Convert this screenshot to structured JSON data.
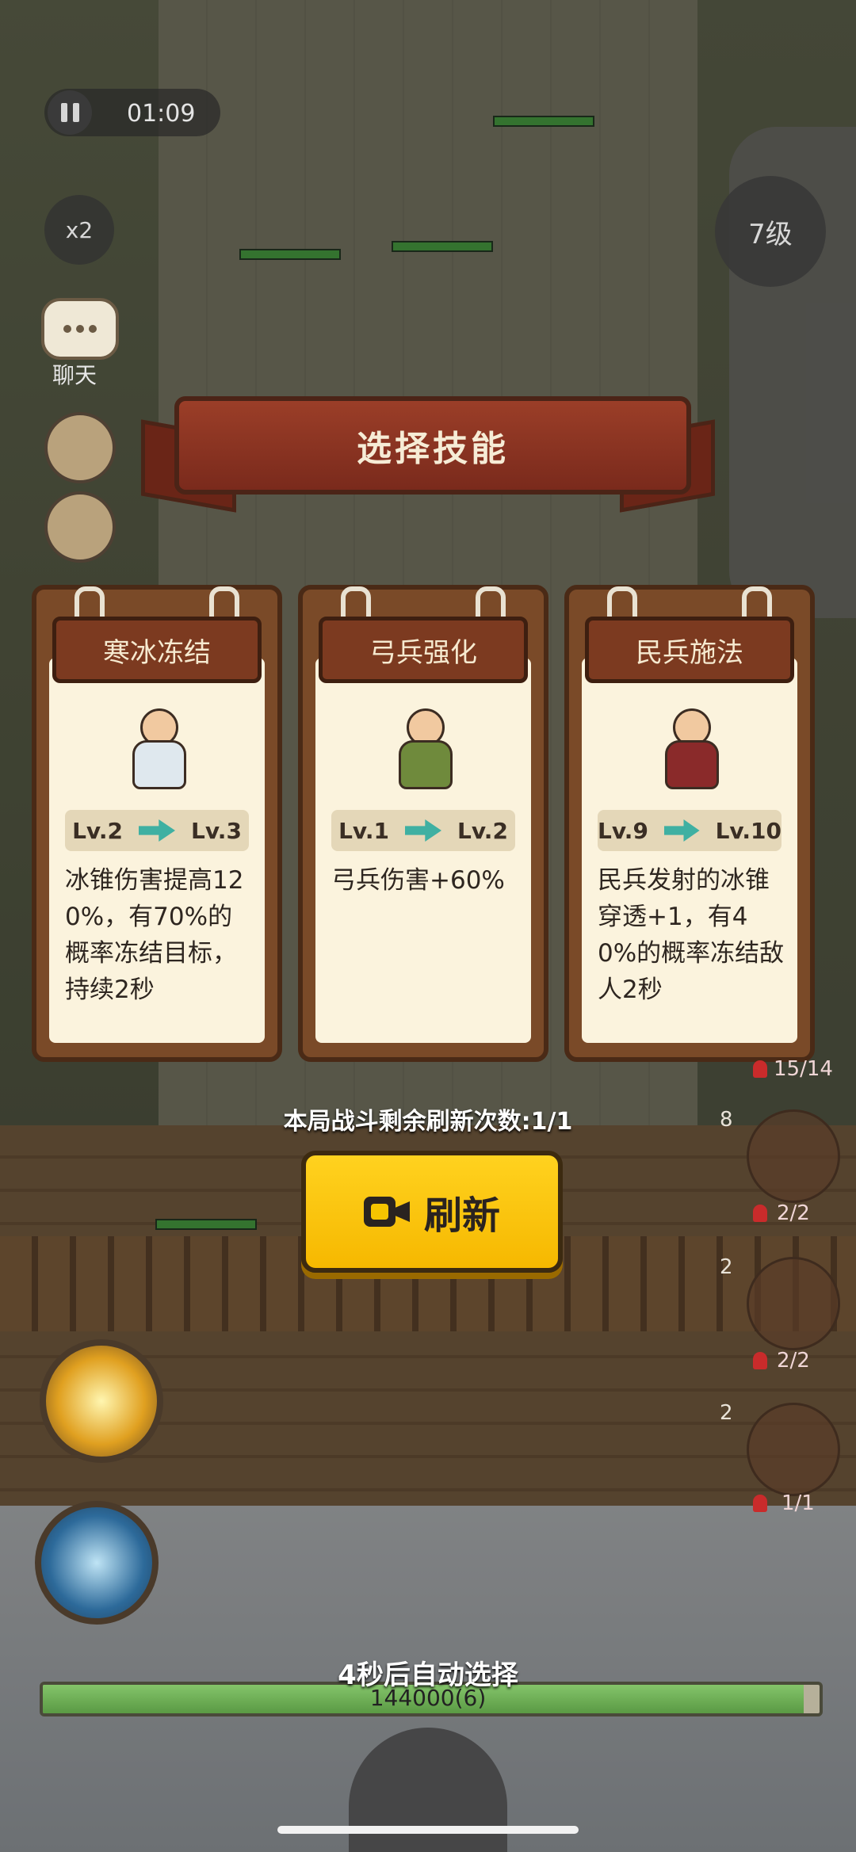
{
  "hud": {
    "timer": "01:09",
    "speed": "x2",
    "chat_label": "聊天",
    "level": "7级"
  },
  "dialog": {
    "title": "选择技能",
    "cards": [
      {
        "name": "寒冰冻结",
        "lv_from": "Lv.2",
        "lv_to": "Lv.3",
        "description": "冰锥伤害提高120%，有70%的概率冻结目标，持续2秒",
        "hero_icon": "ice-strategist-icon",
        "robe_color": "#dfe8ee"
      },
      {
        "name": "弓兵强化",
        "lv_from": "Lv.1",
        "lv_to": "Lv.2",
        "description": "弓兵伤害+60%",
        "hero_icon": "archer-icon",
        "robe_color": "#6f8a3c"
      },
      {
        "name": "民兵施法",
        "lv_from": "Lv.9",
        "lv_to": "Lv.10",
        "description": "民兵发射的冰锥穿透+1，有40%的概率冻结敌人2秒",
        "hero_icon": "militia-icon",
        "robe_color": "#8a2a2a"
      }
    ],
    "refresh_info": "本局战斗剩余刷新次数:1/1",
    "refresh_label": "刷新",
    "auto_select": "4秒后自动选择"
  },
  "units": [
    {
      "count": "15/14"
    },
    {
      "num": "8",
      "count": "2/2"
    },
    {
      "num": "2",
      "count": "2/2"
    },
    {
      "num": "2",
      "count": "1/1"
    }
  ],
  "wall": {
    "hp_text": "144000(6)",
    "fill_fraction": 0.98
  },
  "colors": {
    "accent_button": "#f6b800",
    "banner": "#8a3322",
    "card_paper": "#fbf3dd"
  }
}
